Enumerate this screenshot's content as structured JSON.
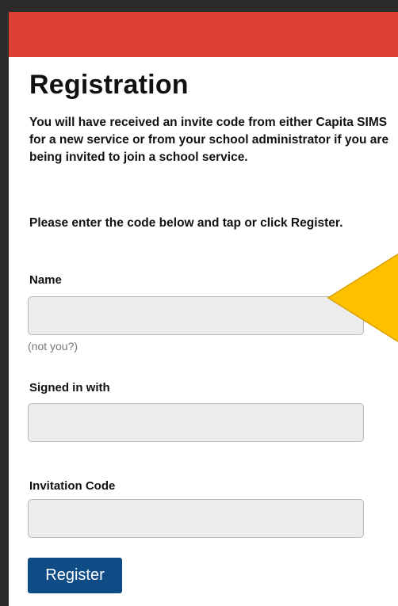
{
  "page": {
    "title": "Registration",
    "intro": "You will have received an invite code from either Capita SIMS for a new service or from your school administrator if you are being invited to join a school service.",
    "instruction": "Please enter the code below and tap or click Register."
  },
  "form": {
    "name_label": "Name",
    "name_value": "",
    "not_you_link": "(not you?)",
    "signed_in_label": "Signed in with",
    "signed_in_value": "",
    "invitation_code_label": "Invitation Code",
    "invitation_code_value": "",
    "register_button": "Register"
  },
  "colors": {
    "header_bar": "#de4134",
    "register_button": "#0f4c85",
    "highlight_marker": "#ffc000"
  }
}
